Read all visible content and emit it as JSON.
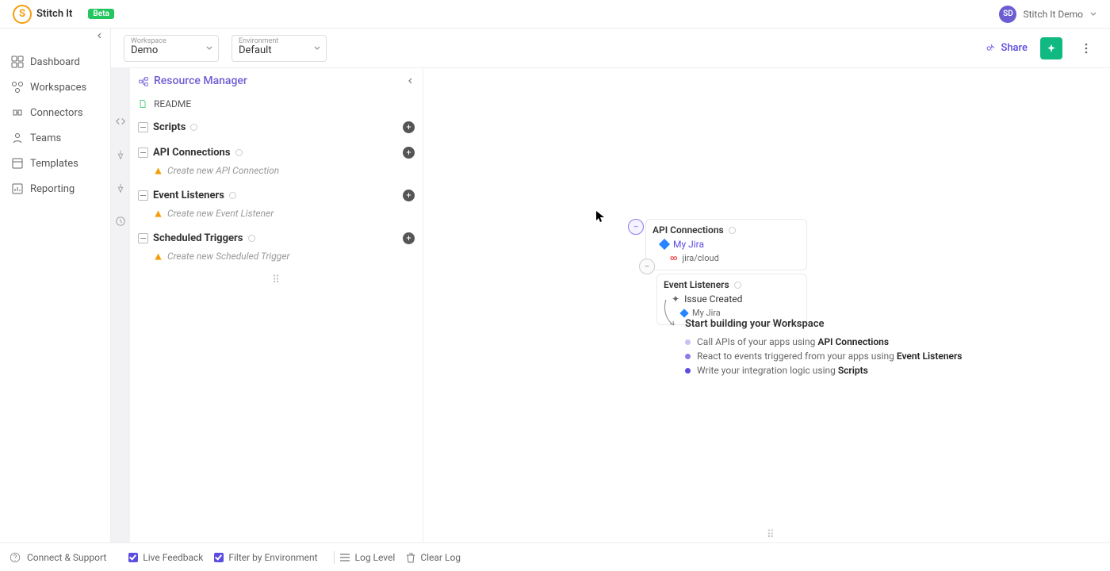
{
  "header": {
    "logo_letter": "S",
    "app_name": "Stitch It",
    "badge": "Beta",
    "user_initials": "SD",
    "user_label": "Stitch It Demo"
  },
  "sidebar": {
    "items": [
      {
        "label": "Dashboard"
      },
      {
        "label": "Workspaces"
      },
      {
        "label": "Connectors"
      },
      {
        "label": "Teams"
      },
      {
        "label": "Templates"
      },
      {
        "label": "Reporting"
      }
    ]
  },
  "ws_bar": {
    "workspace_label": "Workspace",
    "workspace_value": "Demo",
    "env_label": "Environment",
    "env_value": "Default",
    "share": "Share"
  },
  "rm": {
    "title": "Resource Manager",
    "readme": "README",
    "scripts": "Scripts",
    "api_conn": "API Connections",
    "api_conn_create": "Create new API Connection",
    "event_listeners": "Event Listeners",
    "event_listeners_create": "Create new Event Listener",
    "scheduled": "Scheduled Triggers",
    "scheduled_create": "Create new Scheduled Trigger"
  },
  "hint": {
    "api_title": "API Connections",
    "api_item": "My Jira",
    "api_sub": "jira/cloud",
    "evt_title": "Event Listeners",
    "evt_item": "Issue Created",
    "evt_sub": "My Jira",
    "build_title": "Start building your Workspace",
    "b1_a": "Call APIs of your apps using ",
    "b1_b": "API Connections",
    "b2_a": "React to events triggered from your apps using ",
    "b2_b": "Event Listeners",
    "b3_a": "Write your integration logic using ",
    "b3_b": "Scripts"
  },
  "footer": {
    "connect": "Connect & Support",
    "live_feedback": "Live Feedback",
    "filter_env": "Filter by Environment",
    "log_level": "Log Level",
    "clear_log": "Clear Log"
  }
}
